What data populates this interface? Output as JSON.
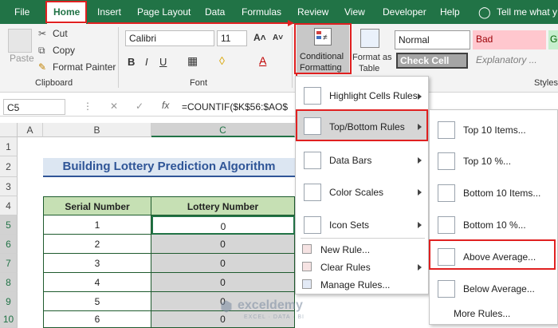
{
  "tabs": [
    "File",
    "Home",
    "Insert",
    "Page Layout",
    "Data",
    "Formulas",
    "Review",
    "View",
    "Developer",
    "Help"
  ],
  "tell_me": "Tell me what y",
  "clipboard": {
    "paste": "Paste",
    "cut": "Cut",
    "copy": "Copy",
    "format_painter": "Format Painter",
    "label": "Clipboard"
  },
  "font": {
    "name": "Calibri",
    "size": "11",
    "label": "Font"
  },
  "cond_format": {
    "line1": "Conditional",
    "line2": "Formatting"
  },
  "format_table": {
    "line1": "Format as",
    "line2": "Table"
  },
  "styles": {
    "normal": "Normal",
    "bad": "Bad",
    "good": "Go",
    "check_cell": "Check Cell",
    "explanatory": "Explanatory ...",
    "label": "Styles"
  },
  "formula_bar": {
    "name_box": "C5",
    "fx": "fx",
    "formula": "=COUNTIF($K$56:$AO$"
  },
  "columns": [
    "A",
    "B",
    "C"
  ],
  "rows": [
    "1",
    "2",
    "3",
    "4",
    "5",
    "6",
    "7",
    "8",
    "9",
    "10"
  ],
  "sheet": {
    "title": "Building Lottery Prediction Algorithm",
    "headers": [
      "Serial Number",
      "Lottery Number"
    ],
    "data": [
      [
        "1",
        "0"
      ],
      [
        "2",
        "0"
      ],
      [
        "3",
        "0"
      ],
      [
        "4",
        "0"
      ],
      [
        "5",
        "0"
      ],
      [
        "6",
        "0"
      ]
    ]
  },
  "menu1": {
    "highlight": "Highlight Cells Rules",
    "topbottom": "Top/Bottom Rules",
    "databars": "Data Bars",
    "colorscales": "Color Scales",
    "iconsets": "Icon Sets",
    "newrule": "New Rule...",
    "clearrules": "Clear Rules",
    "managerules": "Manage Rules..."
  },
  "menu2": {
    "top10": "Top 10 Items...",
    "top10pct": "Top 10 %...",
    "bottom10": "Bottom 10 Items...",
    "bottom10pct": "Bottom 10 %...",
    "above": "Above Average...",
    "below": "Below Average...",
    "more": "More Rules..."
  },
  "watermark": {
    "name": "exceldemy",
    "tag": "EXCEL · DATA · BI"
  },
  "colors": {
    "excel_green": "#217346",
    "highlight_red": "#e02020",
    "title_blue": "#2f5597",
    "title_bg": "#dce6f2",
    "selected_gray": "#d6d6d6"
  }
}
